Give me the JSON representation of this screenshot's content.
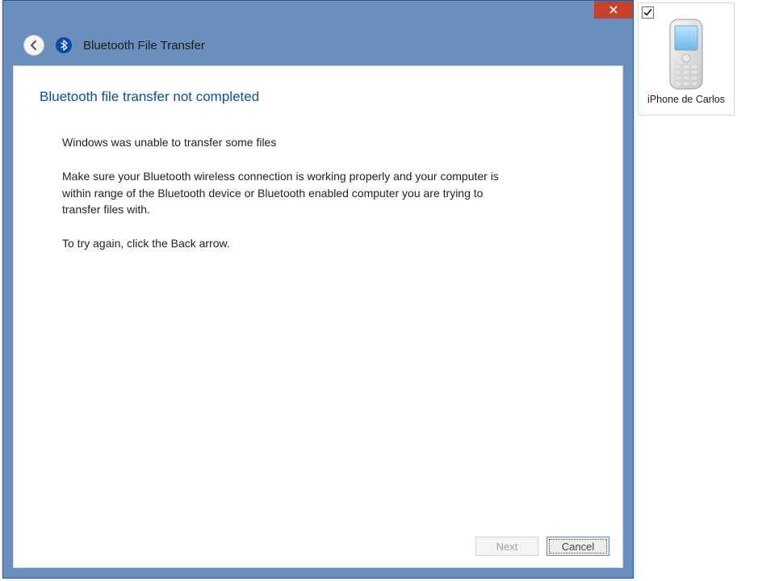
{
  "dialog": {
    "window_title": "Bluetooth File Transfer",
    "heading": "Bluetooth file transfer not completed",
    "line1": "Windows was unable to transfer some files",
    "line2": "Make sure your Bluetooth wireless connection is working properly and your computer is within range of the Bluetooth device or Bluetooth enabled computer you are trying to transfer files with.",
    "line3": "To try again, click the Back arrow.",
    "buttons": {
      "next": "Next",
      "cancel": "Cancel"
    }
  },
  "device": {
    "label": "iPhone de Carlos",
    "checked": true
  }
}
